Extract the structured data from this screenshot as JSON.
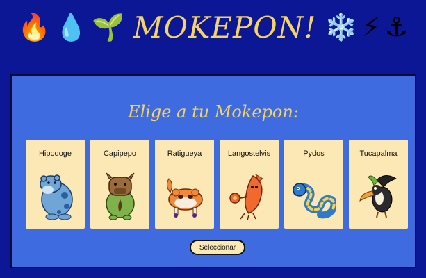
{
  "header": {
    "title": "MOKEPON!",
    "icons_left": [
      {
        "name": "fire-icon",
        "glyph": "🔥"
      },
      {
        "name": "water-drop-icon",
        "glyph": "💧"
      },
      {
        "name": "sprout-icon",
        "glyph": "🌱"
      }
    ],
    "icons_right": [
      {
        "name": "snowflake-icon",
        "glyph": "❄️"
      },
      {
        "name": "lightning-icon",
        "glyph": "⚡"
      },
      {
        "name": "anchor-icon",
        "glyph": "⚓"
      }
    ]
  },
  "panel": {
    "subtitle": "Elige a tu Mokepon:",
    "cards": [
      {
        "name": "Hipodoge"
      },
      {
        "name": "Capipepo"
      },
      {
        "name": "Ratigueya"
      },
      {
        "name": "Langostelvis"
      },
      {
        "name": "Pydos"
      },
      {
        "name": "Tucapalma"
      }
    ],
    "select_label": "Seleccionar"
  },
  "colors": {
    "background": "#0c1796",
    "panel": "#3e6be0",
    "card": "#fce8b4",
    "title": "#f6d365"
  }
}
